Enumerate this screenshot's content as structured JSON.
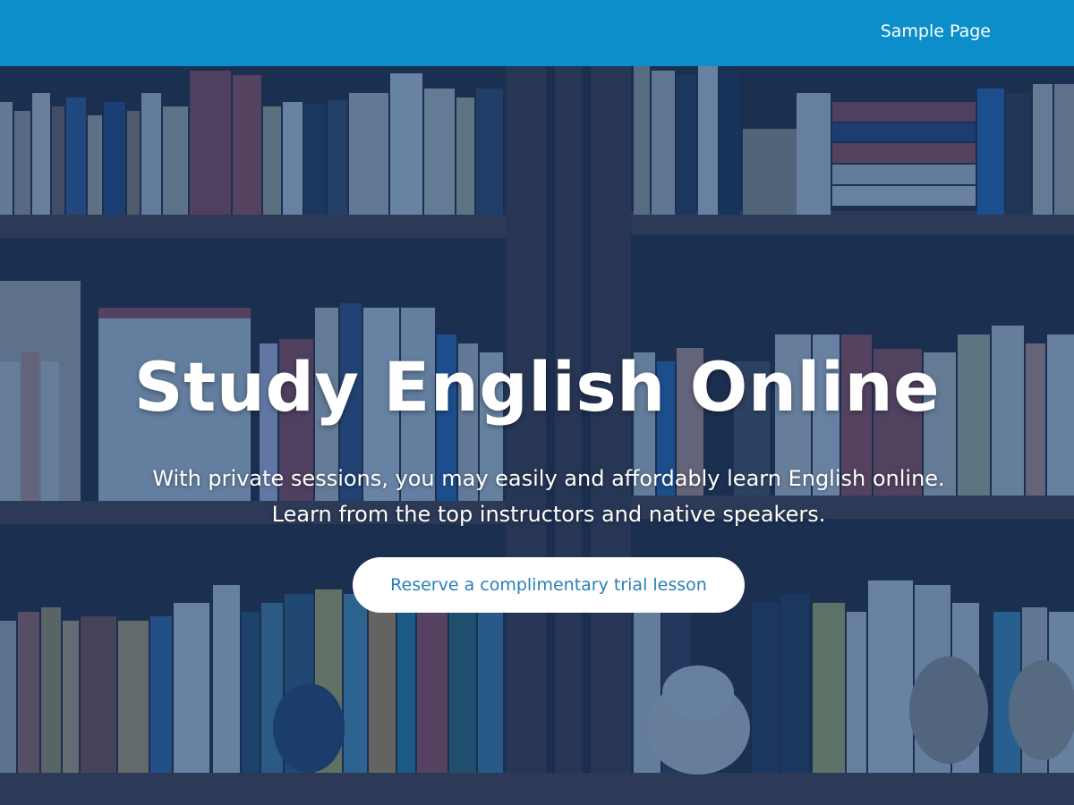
{
  "nav": {
    "sample_page": "Sample Page"
  },
  "hero": {
    "title": "Study English Online",
    "subtitle_line1": "With private sessions, you may easily and affordably learn English online.",
    "subtitle_line2": "Learn from the top instructors and native speakers.",
    "cta_label": "Reserve a complimentary trial lesson",
    "background": "bookshelf-photo"
  },
  "colors": {
    "topbar": "#0b8ec9",
    "overlay": "#123e78",
    "cta_text": "#2a7fb6",
    "cta_bg": "#ffffff"
  }
}
